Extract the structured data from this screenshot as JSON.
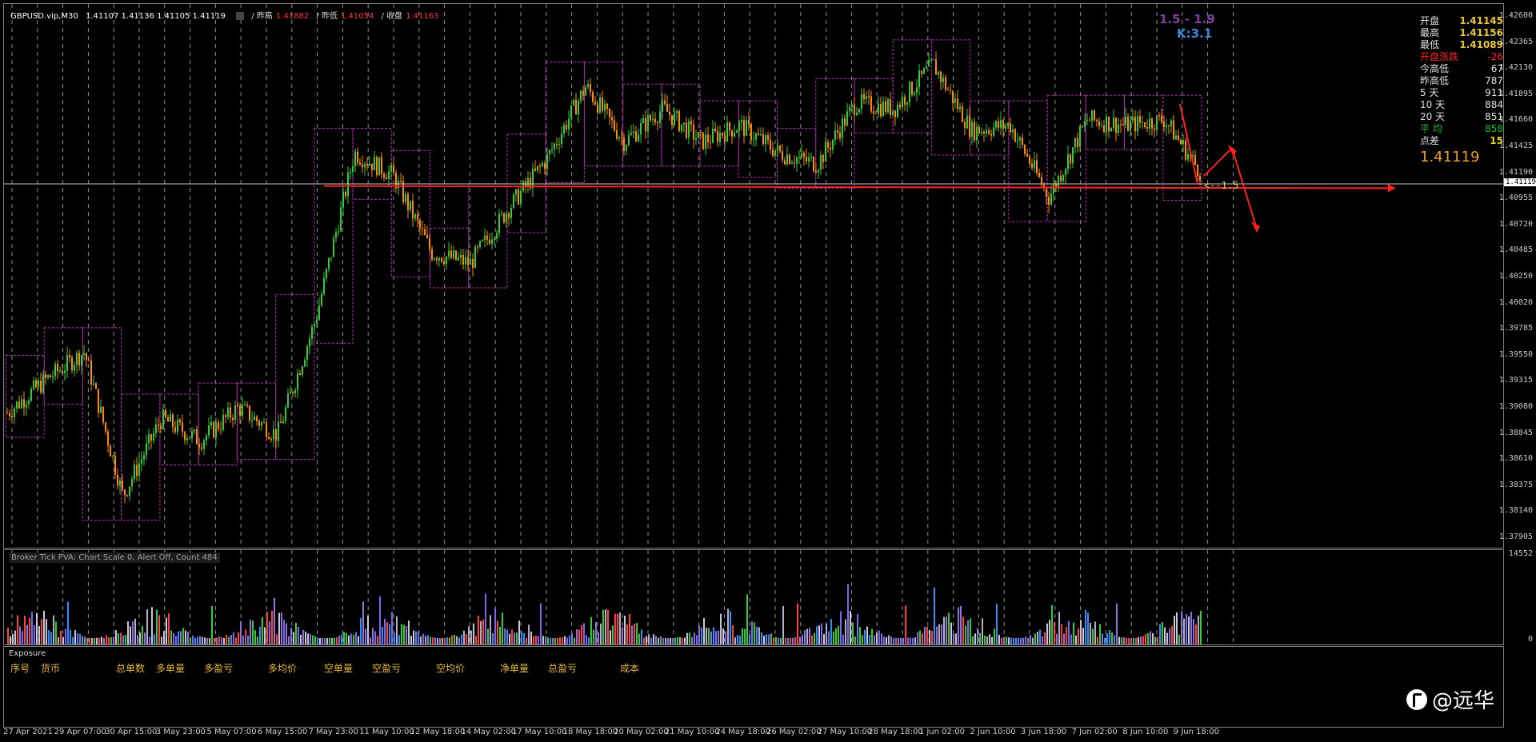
{
  "header": {
    "symbol": "GBPUSD.vip,M30",
    "ohlc": "1.41107 1.41136 1.41105 1.41119",
    "prev_high_label": "/ 昨高",
    "prev_high_value": "1.41882",
    "prev_low_label": "/ 昨低",
    "prev_low_value": "1.41054",
    "close_label": "/ 收盘",
    "close_value": "1.41163"
  },
  "ratio_text": "1.5 - 1.9",
  "k_text": "K:3.1",
  "annotation_text": "<--1.5",
  "info_panel": {
    "rows": [
      {
        "label": "开盘",
        "value": "1.41145",
        "label_color": "#e0e0e0",
        "value_color": "#e6c832"
      },
      {
        "label": "最高",
        "value": "1.41156",
        "label_color": "#e0e0e0",
        "value_color": "#e6c832"
      },
      {
        "label": "最低",
        "value": "1.41089",
        "label_color": "#e0e0e0",
        "value_color": "#e6c832"
      },
      {
        "label": "开盘涨跌",
        "value": "-26",
        "label_color": "#ff2020",
        "value_color": "#ff2020"
      },
      {
        "label": "今高低",
        "value": "67",
        "label_color": "#e0e0e0",
        "value_color": "#e0e0e0"
      },
      {
        "label": "昨高低",
        "value": "787",
        "label_color": "#e0e0e0",
        "value_color": "#e0e0e0"
      },
      {
        "label": "5 天",
        "value": "911",
        "label_color": "#e0e0e0",
        "value_color": "#e0e0e0"
      },
      {
        "label": "10 天",
        "value": "884",
        "label_color": "#e0e0e0",
        "value_color": "#e0e0e0"
      },
      {
        "label": "20 天",
        "value": "851",
        "label_color": "#e0e0e0",
        "value_color": "#e0e0e0"
      },
      {
        "label": "平 均",
        "value": "858",
        "label_color": "#20c020",
        "value_color": "#20c020"
      },
      {
        "label": "点差",
        "value": "15",
        "label_color": "#e0e0e0",
        "value_color": "#e6c832"
      }
    ],
    "big_price": "1.41119"
  },
  "price_axis": [
    "1.42600",
    "1.42365",
    "1.42130",
    "1.41895",
    "1.41660",
    "1.41425",
    "1.41190",
    "1.40955",
    "1.40720",
    "1.40485",
    "1.40250",
    "1.40020",
    "1.39785",
    "1.39550",
    "1.39315",
    "1.39080",
    "1.38845",
    "1.38610",
    "1.38375",
    "1.38140",
    "1.37905"
  ],
  "current_price_label": "1.41119",
  "volume_pane": {
    "title": "Broker Tick PVA:  Chart Scale 0,  Alert Off,  Count  484",
    "max_label": "14552",
    "zero_label": "0"
  },
  "exposure_pane": {
    "title": "Exposure",
    "columns": [
      "序号",
      "货币",
      "总单数",
      "多单量",
      "多盈亏",
      "多均价",
      "空单量",
      "空盈亏",
      "空均价",
      "净单量",
      "总盈亏",
      "成本"
    ]
  },
  "time_axis": [
    "27 Apr 2021",
    "29 Apr 07:00",
    "30 Apr 15:00",
    "3 May 23:00",
    "5 May 07:00",
    "6 May 15:00",
    "7 May 23:00",
    "11 May 10:00",
    "12 May 18:00",
    "14 May 02:00",
    "17 May 10:00",
    "18 May 18:00",
    "20 May 02:00",
    "21 May 10:00",
    "24 May 18:00",
    "26 May 02:00",
    "27 May 10:00",
    "28 May 18:00",
    "1 Jun 02:00",
    "2 Jun 10:00",
    "3 Jun 18:00",
    "7 Jun 02:00",
    "8 Jun 10:00",
    "9 Jun 18:00"
  ],
  "watermark": "@远华",
  "colors": {
    "bull": "#32cd32",
    "bear": "#ff8c00",
    "box": "#b030b0",
    "grid": "#ffffff",
    "arrow": "#ff2020"
  },
  "chart_data": {
    "type": "candlestick",
    "title": "GBPUSD.vip,M30",
    "ylim": [
      1.37905,
      1.426
    ],
    "daily_path": [
      {
        "x": "27 Apr 2021",
        "y": 1.3905
      },
      {
        "x": "28 Apr",
        "y": 1.3935
      },
      {
        "x": "29 Apr",
        "y": 1.396
      },
      {
        "x": "30 Apr",
        "y": 1.383
      },
      {
        "x": "3 May",
        "y": 1.39
      },
      {
        "x": "4 May",
        "y": 1.388
      },
      {
        "x": "5 May",
        "y": 1.391
      },
      {
        "x": "6 May",
        "y": 1.3885
      },
      {
        "x": "7 May",
        "y": 1.399
      },
      {
        "x": "10 May",
        "y": 1.414
      },
      {
        "x": "11 May",
        "y": 1.412
      },
      {
        "x": "12 May",
        "y": 1.405
      },
      {
        "x": "13 May",
        "y": 1.404
      },
      {
        "x": "14 May",
        "y": 1.409
      },
      {
        "x": "17 May",
        "y": 1.4135
      },
      {
        "x": "18 May",
        "y": 1.42
      },
      {
        "x": "19 May",
        "y": 1.415
      },
      {
        "x": "20 May",
        "y": 1.418
      },
      {
        "x": "21 May",
        "y": 1.415
      },
      {
        "x": "24 May",
        "y": 1.4165
      },
      {
        "x": "25 May",
        "y": 1.414
      },
      {
        "x": "26 May",
        "y": 1.413
      },
      {
        "x": "27 May",
        "y": 1.4185
      },
      {
        "x": "28 May",
        "y": 1.418
      },
      {
        "x": "31 May",
        "y": 1.422
      },
      {
        "x": "1 Jun",
        "y": 1.416
      },
      {
        "x": "2 Jun",
        "y": 1.4165
      },
      {
        "x": "3 Jun",
        "y": 1.41
      },
      {
        "x": "4 Jun",
        "y": 1.417
      },
      {
        "x": "7 Jun",
        "y": 1.4165
      },
      {
        "x": "8 Jun",
        "y": 1.417
      },
      {
        "x": "9 Jun",
        "y": 1.4119
      }
    ],
    "support_level": 1.4108,
    "last_price": 1.41119
  }
}
